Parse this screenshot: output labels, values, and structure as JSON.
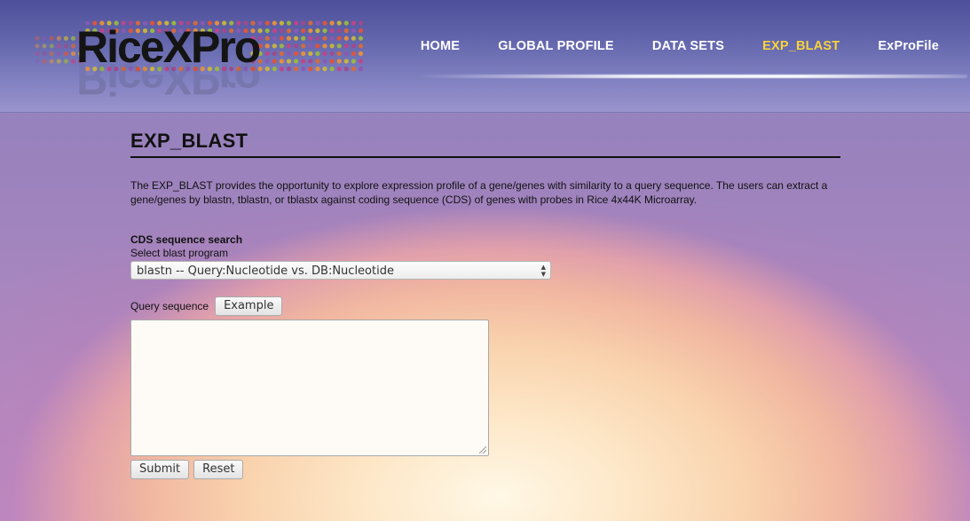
{
  "header": {
    "logo_text": "RiceXPro",
    "nav": [
      {
        "label": "HOME",
        "active": false
      },
      {
        "label": "GLOBAL PROFILE",
        "active": false
      },
      {
        "label": "DATA SETS",
        "active": false
      },
      {
        "label": "EXP_BLAST",
        "active": true
      },
      {
        "label": "ExProFile",
        "active": false
      }
    ],
    "active_color": "#f7d43a"
  },
  "main": {
    "title": "EXP_BLAST",
    "description": "The EXP_BLAST provides the opportunity to explore expression profile of a gene/genes with similarity to a query sequence. The users can extract a gene/genes by blastn, tblastn, or tblastx against coding sequence (CDS) of genes with probes in Rice 4x44K Microarray.",
    "section_label": "CDS sequence search",
    "program_label": "Select blast program",
    "program_selected": "blastn -- Query:Nucleotide vs. DB:Nucleotide",
    "query_label": "Query sequence",
    "example_button": "Example",
    "query_value": "",
    "submit_button": "Submit",
    "reset_button": "Reset"
  }
}
